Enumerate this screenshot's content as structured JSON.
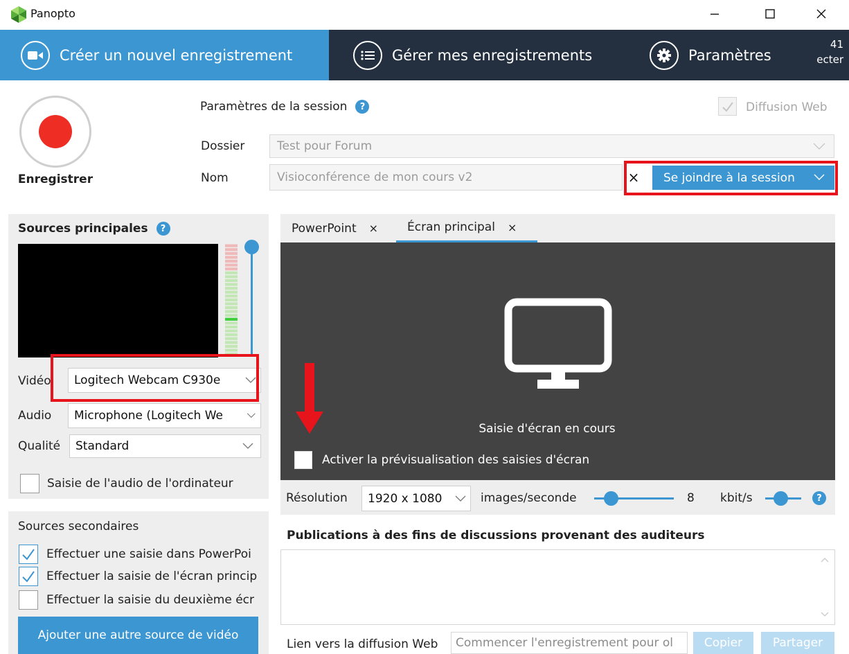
{
  "window": {
    "title": "Panopto",
    "controls": [
      "minimize-icon",
      "maximize-icon",
      "close-icon"
    ]
  },
  "nav": {
    "tabs": [
      {
        "label": "Créer un nouvel enregistrement",
        "icon": "video-camera-icon",
        "active": true
      },
      {
        "label": "Gérer mes enregistrements",
        "icon": "list-icon",
        "active": false
      },
      {
        "label": "Paramètres",
        "icon": "gear-icon",
        "active": false
      }
    ],
    "clipped_line1": "41",
    "clipped_line2": "ecter"
  },
  "record": {
    "label": "Enregistrer"
  },
  "session": {
    "title": "Paramètres de la session",
    "help": "?",
    "diffusion_label": "Diffusion Web",
    "diffusion_checked": true,
    "folder_label": "Dossier",
    "folder_value": "Test pour Forum",
    "name_label": "Nom",
    "name_value": "Visioconférence de mon cours v2",
    "clear": "×",
    "join_label": "Se joindre à la session"
  },
  "primary": {
    "title": "Sources principales",
    "help": "?",
    "video_label": "Vidéo",
    "video_value": "Logitech Webcam C930e",
    "audio_label": "Audio",
    "audio_value": "Microphone (Logitech We",
    "quality_label": "Qualité",
    "quality_value": "Standard",
    "system_audio_label": "Saisie de l'audio de l'ordinateur",
    "system_audio_checked": false
  },
  "secondary": {
    "title": "Sources secondaires",
    "items": [
      {
        "label": "Effectuer une saisie dans PowerPoi",
        "checked": true
      },
      {
        "label": "Effectuer la saisie de l'écran princip",
        "checked": true
      },
      {
        "label": "Effectuer la saisie du deuxième écr",
        "checked": false
      }
    ],
    "add_button": "Ajouter une autre source de vidéo"
  },
  "preview": {
    "tabs": [
      {
        "label": "PowerPoint",
        "close": "×",
        "active": false
      },
      {
        "label": "Écran principal",
        "close": "×",
        "active": true
      }
    ],
    "status": "Saisie d'écran en cours",
    "enable_preview_label": "Activer la prévisualisation des saisies d'écran",
    "enable_preview_checked": false
  },
  "settings": {
    "resolution_label": "Résolution",
    "resolution_value": "1920 x 1080",
    "fps_label": "images/seconde",
    "fps_value": "8",
    "kbit_label": "kbit/s",
    "help": "?"
  },
  "discussion": {
    "title": "Publications à des fins de discussions provenant des auditeurs"
  },
  "weblink": {
    "label": "Lien vers la diffusion Web",
    "placeholder": "Commencer l'enregistrement pour ol",
    "copy_label": "Copier",
    "share_label": "Partager"
  },
  "colors": {
    "accent": "#3b96d2",
    "nav_background": "#243040",
    "record_red": "#ee2e24",
    "highlight_red": "#e8141b",
    "preview_background": "#434343"
  }
}
